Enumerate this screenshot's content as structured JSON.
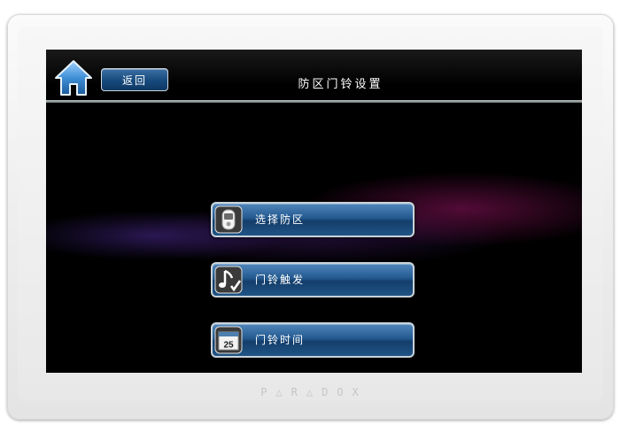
{
  "header": {
    "back_label": "返回",
    "title": "防区门铃设置"
  },
  "menu": {
    "items": [
      {
        "label": "选择防区",
        "icon": "keyfob-icon"
      },
      {
        "label": "门铃触发",
        "icon": "music-note-check-icon"
      },
      {
        "label": "门铃时间",
        "icon": "calendar-icon",
        "icon_text": "25"
      }
    ]
  },
  "device": {
    "brand": "P△R△DOX"
  },
  "colors": {
    "button_blue": "#23598f",
    "home_blue": "#3f8fd6"
  }
}
